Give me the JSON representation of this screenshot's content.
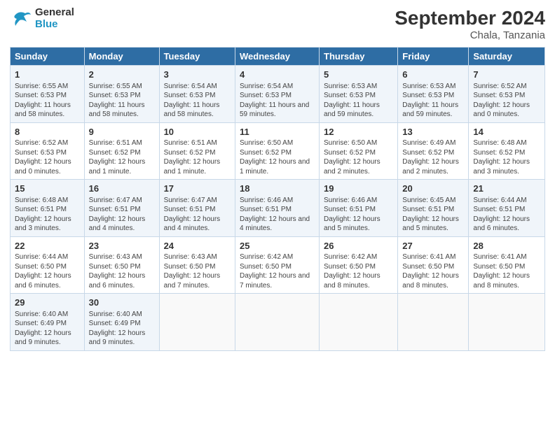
{
  "header": {
    "logo_line1": "General",
    "logo_line2": "Blue",
    "month_title": "September 2024",
    "location": "Chala, Tanzania"
  },
  "weekdays": [
    "Sunday",
    "Monday",
    "Tuesday",
    "Wednesday",
    "Thursday",
    "Friday",
    "Saturday"
  ],
  "weeks": [
    [
      {
        "day": 1,
        "info": "Sunrise: 6:55 AM\nSunset: 6:53 PM\nDaylight: 11 hours and 58 minutes."
      },
      {
        "day": 2,
        "info": "Sunrise: 6:55 AM\nSunset: 6:53 PM\nDaylight: 11 hours and 58 minutes."
      },
      {
        "day": 3,
        "info": "Sunrise: 6:54 AM\nSunset: 6:53 PM\nDaylight: 11 hours and 58 minutes."
      },
      {
        "day": 4,
        "info": "Sunrise: 6:54 AM\nSunset: 6:53 PM\nDaylight: 11 hours and 59 minutes."
      },
      {
        "day": 5,
        "info": "Sunrise: 6:53 AM\nSunset: 6:53 PM\nDaylight: 11 hours and 59 minutes."
      },
      {
        "day": 6,
        "info": "Sunrise: 6:53 AM\nSunset: 6:53 PM\nDaylight: 11 hours and 59 minutes."
      },
      {
        "day": 7,
        "info": "Sunrise: 6:52 AM\nSunset: 6:53 PM\nDaylight: 12 hours and 0 minutes."
      }
    ],
    [
      {
        "day": 8,
        "info": "Sunrise: 6:52 AM\nSunset: 6:53 PM\nDaylight: 12 hours and 0 minutes."
      },
      {
        "day": 9,
        "info": "Sunrise: 6:51 AM\nSunset: 6:52 PM\nDaylight: 12 hours and 1 minute."
      },
      {
        "day": 10,
        "info": "Sunrise: 6:51 AM\nSunset: 6:52 PM\nDaylight: 12 hours and 1 minute."
      },
      {
        "day": 11,
        "info": "Sunrise: 6:50 AM\nSunset: 6:52 PM\nDaylight: 12 hours and 1 minute."
      },
      {
        "day": 12,
        "info": "Sunrise: 6:50 AM\nSunset: 6:52 PM\nDaylight: 12 hours and 2 minutes."
      },
      {
        "day": 13,
        "info": "Sunrise: 6:49 AM\nSunset: 6:52 PM\nDaylight: 12 hours and 2 minutes."
      },
      {
        "day": 14,
        "info": "Sunrise: 6:48 AM\nSunset: 6:52 PM\nDaylight: 12 hours and 3 minutes."
      }
    ],
    [
      {
        "day": 15,
        "info": "Sunrise: 6:48 AM\nSunset: 6:51 PM\nDaylight: 12 hours and 3 minutes."
      },
      {
        "day": 16,
        "info": "Sunrise: 6:47 AM\nSunset: 6:51 PM\nDaylight: 12 hours and 4 minutes."
      },
      {
        "day": 17,
        "info": "Sunrise: 6:47 AM\nSunset: 6:51 PM\nDaylight: 12 hours and 4 minutes."
      },
      {
        "day": 18,
        "info": "Sunrise: 6:46 AM\nSunset: 6:51 PM\nDaylight: 12 hours and 4 minutes."
      },
      {
        "day": 19,
        "info": "Sunrise: 6:46 AM\nSunset: 6:51 PM\nDaylight: 12 hours and 5 minutes."
      },
      {
        "day": 20,
        "info": "Sunrise: 6:45 AM\nSunset: 6:51 PM\nDaylight: 12 hours and 5 minutes."
      },
      {
        "day": 21,
        "info": "Sunrise: 6:44 AM\nSunset: 6:51 PM\nDaylight: 12 hours and 6 minutes."
      }
    ],
    [
      {
        "day": 22,
        "info": "Sunrise: 6:44 AM\nSunset: 6:50 PM\nDaylight: 12 hours and 6 minutes."
      },
      {
        "day": 23,
        "info": "Sunrise: 6:43 AM\nSunset: 6:50 PM\nDaylight: 12 hours and 6 minutes."
      },
      {
        "day": 24,
        "info": "Sunrise: 6:43 AM\nSunset: 6:50 PM\nDaylight: 12 hours and 7 minutes."
      },
      {
        "day": 25,
        "info": "Sunrise: 6:42 AM\nSunset: 6:50 PM\nDaylight: 12 hours and 7 minutes."
      },
      {
        "day": 26,
        "info": "Sunrise: 6:42 AM\nSunset: 6:50 PM\nDaylight: 12 hours and 8 minutes."
      },
      {
        "day": 27,
        "info": "Sunrise: 6:41 AM\nSunset: 6:50 PM\nDaylight: 12 hours and 8 minutes."
      },
      {
        "day": 28,
        "info": "Sunrise: 6:41 AM\nSunset: 6:50 PM\nDaylight: 12 hours and 8 minutes."
      }
    ],
    [
      {
        "day": 29,
        "info": "Sunrise: 6:40 AM\nSunset: 6:49 PM\nDaylight: 12 hours and 9 minutes."
      },
      {
        "day": 30,
        "info": "Sunrise: 6:40 AM\nSunset: 6:49 PM\nDaylight: 12 hours and 9 minutes."
      },
      null,
      null,
      null,
      null,
      null
    ]
  ]
}
